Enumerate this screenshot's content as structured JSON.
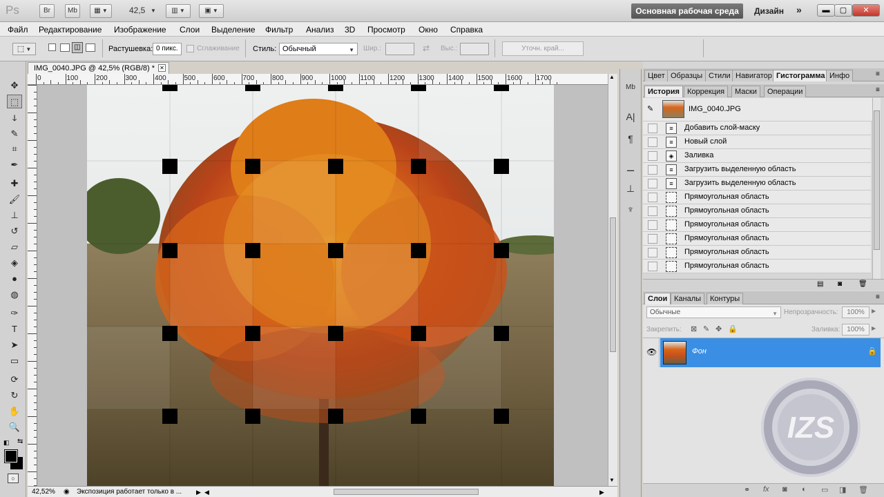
{
  "app": {
    "logo": "Ps",
    "btn_br": "Br",
    "btn_mb": "Mb",
    "zoom": "42,5",
    "workspace": "Основная рабочая среда",
    "design": "Дизайн",
    "more": "»"
  },
  "menu": [
    "Файл",
    "Редактирование",
    "Изображение",
    "Слои",
    "Выделение",
    "Фильтр",
    "Анализ",
    "3D",
    "Просмотр",
    "Окно",
    "Справка"
  ],
  "options": {
    "feather_label": "Растушевка:",
    "feather_value": "0 пикс.",
    "antialias_label": "Сглаживание",
    "style_label": "Стиль:",
    "style_value": "Обычный",
    "width_label": "Шир.:",
    "height_label": "Выс.:",
    "refine_edge": "Уточн. край..."
  },
  "document": {
    "tab_title": "IMG_0040.JPG @ 42,5% (RGB/8) *",
    "ruler_labels": [
      "0",
      "100",
      "200",
      "300",
      "400",
      "500",
      "600",
      "700",
      "800",
      "900",
      "1000",
      "1100",
      "1200",
      "1300",
      "1400",
      "1500",
      "1600",
      "1700"
    ]
  },
  "status": {
    "zoom": "42,52%",
    "message": "Экспозиция работает только в ..."
  },
  "panels": {
    "top_tabs": [
      "Цвет",
      "Образцы",
      "Стили",
      "Навигатор",
      "Гистограмма",
      "Инфо"
    ],
    "mid_tabs": [
      "История",
      "Коррекция",
      "Маски",
      "Операции"
    ],
    "history_snapshot": "IMG_0040.JPG",
    "history": [
      {
        "label": "Добавить слой-маску",
        "icon": "doc"
      },
      {
        "label": "Новый слой",
        "icon": "doc"
      },
      {
        "label": "Заливка",
        "icon": "bucket"
      },
      {
        "label": "Загрузить выделенную область",
        "icon": "doc"
      },
      {
        "label": "Загрузить выделенную область",
        "icon": "doc"
      },
      {
        "label": "Прямоугольная область",
        "icon": "marquee"
      },
      {
        "label": "Прямоугольная область",
        "icon": "marquee"
      },
      {
        "label": "Прямоугольная область",
        "icon": "marquee"
      },
      {
        "label": "Прямоугольная область",
        "icon": "marquee"
      },
      {
        "label": "Прямоугольная область",
        "icon": "marquee"
      },
      {
        "label": "Прямоугольная область",
        "icon": "marquee"
      }
    ],
    "layer_tabs": [
      "Слои",
      "Каналы",
      "Контуры"
    ],
    "blend_mode": "Обычные",
    "opacity_label": "Непрозрачность:",
    "opacity_value": "100%",
    "lock_label": "Закрепить:",
    "fill_label": "Заливка:",
    "fill_value": "100%",
    "layer_name": "Фон"
  },
  "colors": {
    "accent": "#3a8fe4",
    "foreground": "#000000",
    "background": "#ffffff"
  }
}
